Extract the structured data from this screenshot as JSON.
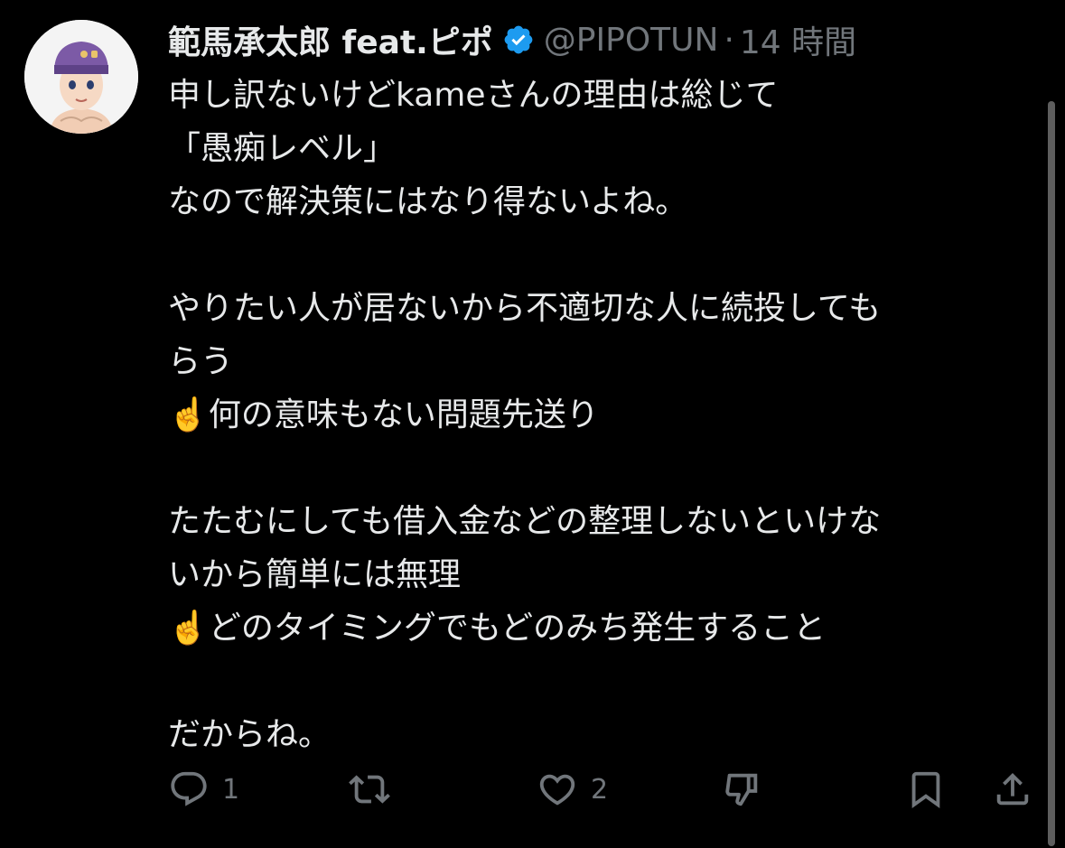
{
  "tweet": {
    "author": {
      "display_name": "範馬承太郎 feat.ピポ",
      "handle": "@PIPOTUN",
      "separator": "·",
      "time": "14 時間",
      "verified": true
    },
    "lines": [
      "申し訳ないけどkameさんの理由は総じて",
      "「愚痴レベル」",
      "なので解決策にはなり得ないよね。",
      "",
      "やりたい人が居ないから不適切な人に続投しても",
      "らう",
      "☝️何の意味もない問題先送り",
      "",
      "たたむにしても借入金などの整理しないといけな",
      "いから簡単には無理",
      "☝️どのタイミングでもどのみち発生すること",
      "",
      "だからね。"
    ],
    "actions": {
      "reply_count": "1",
      "retweet_count": "",
      "like_count": "2"
    }
  },
  "icons": {
    "reply": "reply-icon",
    "retweet": "retweet-icon",
    "like": "heart-icon",
    "dislike": "dislike-icon",
    "bookmark": "bookmark-icon",
    "share": "share-icon",
    "verified": "verified-badge-icon"
  },
  "colors": {
    "background": "#000000",
    "text": "#e7e9ea",
    "muted": "#71767b",
    "verified_blue": "#1d9bf0"
  }
}
